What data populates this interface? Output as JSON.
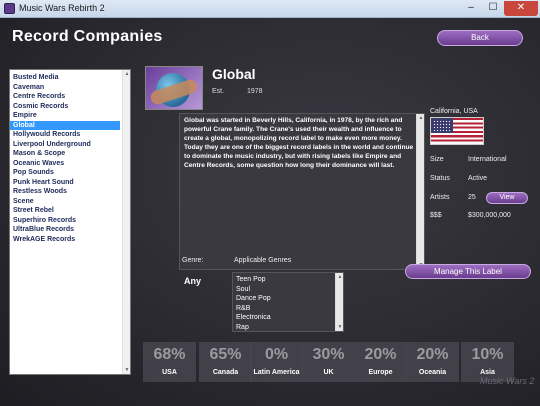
{
  "window": {
    "title": "Music Wars Rebirth 2",
    "minimize": "–",
    "maximize": "☐",
    "close": "✕"
  },
  "page_title": "Record Companies",
  "buttons": {
    "back": "Back",
    "manage": "Manage This Label",
    "view": "View"
  },
  "companies": [
    "Busted Media",
    "Caveman",
    "Centre Records",
    "Cosmic Records",
    "Empire",
    "Global",
    "Hollywould Records",
    "Liverpool Underground",
    "Mason & Scope",
    "Oceanic Waves",
    "Pop Sounds",
    "Punk Heart Sound",
    "Restless Woods",
    "Scene",
    "Street Rebel",
    "Superhiro Records",
    "UltraBlue Records",
    "WrekAGE Records"
  ],
  "selected_company": "Global",
  "label": {
    "name": "Global",
    "est_label": "Est.",
    "est_year": "1978",
    "description": "Global was started in Beverly Hills, California, in 1978, by the rich and powerful Crane family.  The Crane's used their wealth and influence to create a global, monopolizing record label to make even more money. Today they are one of the biggest record labels in the world and continue to dominate the music industry, but with rising labels like Empire and Centre Records, some question how long their dominance will last.",
    "country": "California, USA",
    "flag_icon": "us-flag-icon"
  },
  "info": {
    "size_label": "Size",
    "size_value": "International",
    "status_label": "Status",
    "status_value": "Active",
    "artists_label": "Artists",
    "artists_value": "25",
    "money_label": "$$$",
    "money_value": "$300,000,000"
  },
  "genres": {
    "label": "Genre:",
    "applicable_label": "Applicable Genres",
    "selected": "Any",
    "items": [
      "Teen Pop",
      "Soul",
      "Dance Pop",
      "R&B",
      "Electronica",
      "Rap"
    ]
  },
  "market_share": [
    {
      "region": "USA",
      "pct": "68%"
    },
    {
      "region": "Canada",
      "pct": "65%"
    },
    {
      "region": "Latin America",
      "pct": "0%"
    },
    {
      "region": "UK",
      "pct": "30%"
    },
    {
      "region": "Europe",
      "pct": "20%"
    },
    {
      "region": "Oceania",
      "pct": "20%"
    },
    {
      "region": "Asia",
      "pct": "10%"
    }
  ],
  "colors": {
    "accent": "#7b4aa3",
    "selection": "#3399ff",
    "background": "#2a292f"
  }
}
